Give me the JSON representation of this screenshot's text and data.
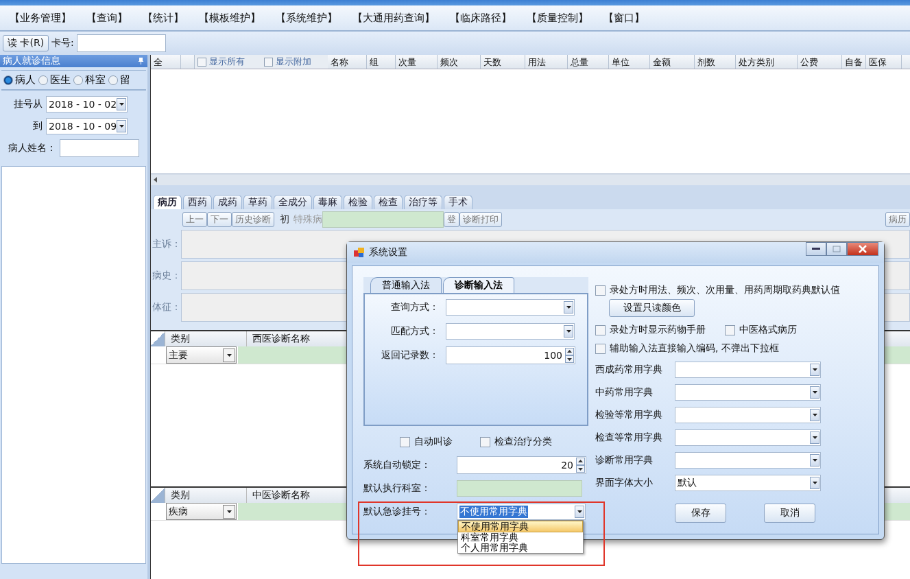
{
  "menu": [
    "【业务管理】",
    "【查询】",
    "【统计】",
    "【模板维护】",
    "【系统维护】",
    "【大通用药查询】",
    "【临床路径】",
    "【质量控制】",
    "【窗口】"
  ],
  "toolbar": {
    "read_card_button": "读 卡(R)",
    "card_label": "卡号:"
  },
  "patient_panel": {
    "title": "病人就诊信息",
    "filters": [
      {
        "label": "病人",
        "selected": true
      },
      {
        "label": "医生",
        "selected": false
      },
      {
        "label": "科室",
        "selected": false
      },
      {
        "label": "留",
        "selected": false
      }
    ],
    "date_from_label": "挂号从",
    "date_from": "2018 - 10 - 02",
    "date_to_label": "到",
    "date_to": "2018 - 10 - 09",
    "name_label": "病人姓名："
  },
  "prescription_table": {
    "lead_column": "全",
    "options": [
      {
        "label": "显示所有",
        "checked": false
      },
      {
        "label": "显示附加",
        "checked": false
      }
    ],
    "columns": [
      "名称",
      "组",
      "次量",
      "频次",
      "天数",
      "用法",
      "总量",
      "单位",
      "金额",
      "剂数",
      "处方类别",
      "公费",
      "自备",
      "医保"
    ]
  },
  "record_tabs": [
    {
      "label": "病历",
      "selected": true
    },
    {
      "label": "西药",
      "selected": false
    },
    {
      "label": "成药",
      "selected": false
    },
    {
      "label": "草药",
      "selected": false
    },
    {
      "label": "全成分",
      "selected": false
    },
    {
      "label": "毒麻",
      "selected": false
    },
    {
      "label": "检验",
      "selected": false
    },
    {
      "label": "检查",
      "selected": false
    },
    {
      "label": "治疗等",
      "selected": false
    },
    {
      "label": "手术",
      "selected": false
    }
  ],
  "record_toolbar": {
    "nav_buttons": [
      "上一",
      "下一",
      "历史诊断"
    ],
    "first_visit_label": "初",
    "special_label": "特殊病",
    "register_button": "登",
    "print_button": "诊断打印",
    "record_button": "病历"
  },
  "record_fields": [
    "主诉：",
    "病史：",
    "体征："
  ],
  "western_diagnosis": {
    "columns": [
      "类别",
      "西医诊断名称"
    ],
    "category": "主要"
  },
  "chinese_diagnosis": {
    "columns": [
      "类别",
      "中医诊断名称"
    ],
    "category": "疾病"
  },
  "dialog": {
    "title": "系统设置",
    "tabs": [
      {
        "label": "普通输入法",
        "selected": false
      },
      {
        "label": "诊断输入法",
        "selected": true
      }
    ],
    "query_label": "查询方式：",
    "match_label": "匹配方式：",
    "records_label": "返回记录数：",
    "records_value": "100",
    "auto_call": {
      "label": "自动叫诊",
      "checked": false
    },
    "exam_category": {
      "label": "检查治疗分类",
      "checked": false
    },
    "lock_label": "系统自动锁定：",
    "lock_value": "20",
    "dept_label": "默认执行科室：",
    "emergency_label": "默认急诊挂号：",
    "emergency_value": "不使用常用字典",
    "emergency_options": [
      {
        "label": "不使用常用字典",
        "selected": true
      },
      {
        "label": "科室常用字典",
        "selected": false
      },
      {
        "label": "个人用常用字典",
        "selected": false
      }
    ],
    "default_usage": {
      "label": "录处方时用法、频次、次用量、用药周期取药典默认值",
      "checked": false
    },
    "readonly_color_button": "设置只读颜色",
    "drug_manual": {
      "label": "录处方时显示药物手册",
      "checked": false
    },
    "tcm_format": {
      "label": "中医格式病历",
      "checked": false
    },
    "direct_code": {
      "label": "辅助输入法直接输入编码, 不弹出下拉框",
      "checked": false
    },
    "dictionaries": [
      {
        "label": "西成药常用字典"
      },
      {
        "label": "中药常用字典"
      },
      {
        "label": "检验等常用字典"
      },
      {
        "label": "检查等常用字典"
      },
      {
        "label": "诊断常用字典"
      },
      {
        "label": "界面字体大小",
        "value": "默认"
      }
    ],
    "save_button": "保存",
    "cancel_button": "取消"
  }
}
